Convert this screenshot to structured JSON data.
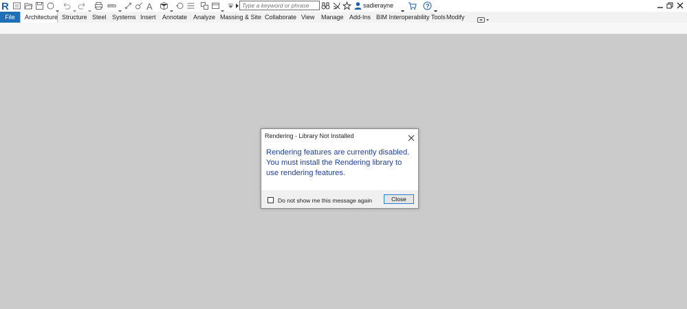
{
  "search": {
    "placeholder": "Type a keyword or phrase"
  },
  "user": {
    "name": "sadierayne"
  },
  "ribbon": {
    "file_label": "File",
    "tabs": [
      {
        "label": "Architecture"
      },
      {
        "label": "Structure"
      },
      {
        "label": "Steel"
      },
      {
        "label": "Systems"
      },
      {
        "label": "Insert"
      },
      {
        "label": "Annotate"
      },
      {
        "label": "Analyze"
      },
      {
        "label": "Massing & Site"
      },
      {
        "label": "Collaborate"
      },
      {
        "label": "View"
      },
      {
        "label": "Manage"
      },
      {
        "label": "Add-Ins"
      },
      {
        "label": "BIM Interoperability Tools"
      },
      {
        "label": "Modify"
      }
    ]
  },
  "dialog": {
    "title": "Rendering - Library Not Installed",
    "message": "Rendering features are currently disabled. You must install the Rendering library to use rendering features.",
    "checkbox_label": "Do not show me this message again",
    "close_label": "Close"
  },
  "colors": {
    "file_tab": "#1e6fb5",
    "dialog_message": "#1e3e9a",
    "background": "#cbcbcb",
    "button_border": "#2d7bd0"
  }
}
